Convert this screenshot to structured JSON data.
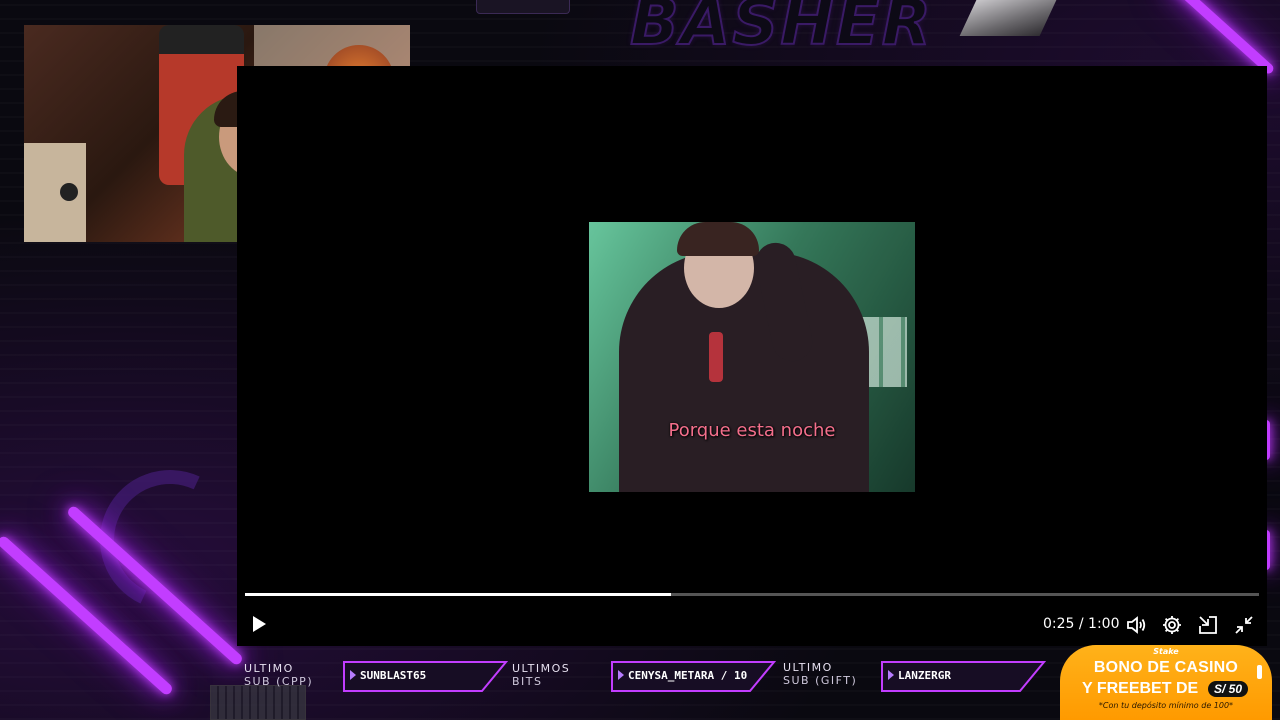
{
  "overlay": {
    "brand_text": "BASHER",
    "accent_color": "#c23dff"
  },
  "player": {
    "caption": "Porque esta noche",
    "progress": 0.42,
    "time": "0:25 / 1:00",
    "controls": [
      "play-icon",
      "volume-icon",
      "gear-icon",
      "pip-icon",
      "exit-fullscreen-icon"
    ]
  },
  "stats": [
    {
      "label": "ULTIMO",
      "sub": "SUB (CPP)",
      "value": "SUNBLAST65"
    },
    {
      "label": "ULTIMOS",
      "sub": "BITS",
      "value": "CENYSA_METARA / 10"
    },
    {
      "label": "ULTIMO",
      "sub": "SUB (GIFT)",
      "value": "LANZERGR"
    }
  ],
  "ad": {
    "brand": "Stake",
    "line1": "BONO DE CASINO",
    "line2": "Y FREEBET DE",
    "amount": "S/ 50",
    "note": "*Con tu depósito mínimo de 100*"
  }
}
